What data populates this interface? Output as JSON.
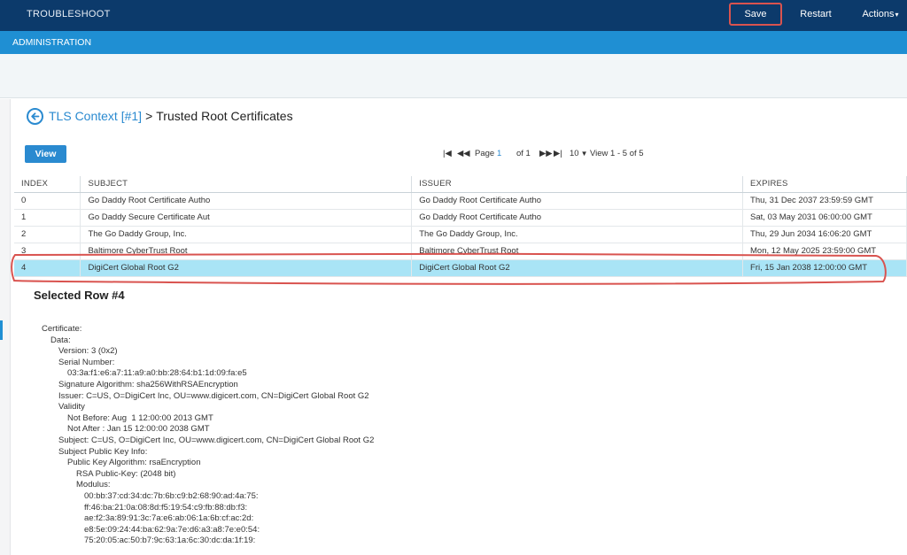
{
  "topbar": {
    "brand": "TROUBLESHOOT",
    "save_label": "Save",
    "restart_label": "Restart",
    "actions_label": "Actions",
    "highlight_color": "#d9534f"
  },
  "subbar": {
    "title": "ADMINISTRATION"
  },
  "breadcrumb": {
    "link": "TLS Context [#1]",
    "separator": ">",
    "current": "Trusted Root Certificates"
  },
  "toolbar": {
    "view_label": "View"
  },
  "pager": {
    "page_label": "Page",
    "page_number": "1",
    "of_label": "of 1",
    "page_size": "10",
    "view_text": "View 1 - 5 of 5"
  },
  "table": {
    "headers": [
      "INDEX",
      "SUBJECT",
      "ISSUER",
      "EXPIRES"
    ],
    "rows": [
      [
        "0",
        "Go Daddy Root Certificate Autho",
        "Go Daddy Root Certificate Autho",
        "Thu, 31 Dec 2037 23:59:59 GMT"
      ],
      [
        "1",
        "Go Daddy Secure Certificate Aut",
        "Go Daddy Root Certificate Autho",
        "Sat, 03 May 2031 06:00:00 GMT"
      ],
      [
        "2",
        "The Go Daddy Group, Inc.",
        "The Go Daddy Group, Inc.",
        "Thu, 29 Jun 2034 16:06:20 GMT"
      ],
      [
        "3",
        "Baltimore CyberTrust Root",
        "Baltimore CyberTrust Root",
        "Mon, 12 May 2025 23:59:00 GMT"
      ],
      [
        "4",
        "DigiCert Global Root G2",
        "DigiCert Global Root G2",
        "Fri, 15 Jan 2038 12:00:00 GMT"
      ]
    ],
    "selected_index": 4,
    "selected_color": "#a9e4f6"
  },
  "selected": {
    "title": "Selected Row #4"
  },
  "certificate": {
    "lines": [
      "Certificate:",
      "Data:",
      "Version: 3 (0x2)",
      "Serial Number:",
      "03:3a:f1:e6:a7:11:a9:a0:bb:28:64:b1:1d:09:fa:e5",
      "Signature Algorithm: sha256WithRSAEncryption",
      "Issuer: C=US, O=DigiCert Inc, OU=www.digicert.com, CN=DigiCert Global Root G2",
      "Validity",
      "Not Before: Aug  1 12:00:00 2013 GMT",
      "Not After : Jan 15 12:00:00 2038 GMT",
      "Subject: C=US, O=DigiCert Inc, OU=www.digicert.com, CN=DigiCert Global Root G2",
      "Subject Public Key Info:",
      "Public Key Algorithm: rsaEncryption",
      "RSA Public-Key: (2048 bit)",
      "Modulus:",
      "00:bb:37:cd:34:dc:7b:6b:c9:b2:68:90:ad:4a:75:",
      "ff:46:ba:21:0a:08:8d:f5:19:54:c9:fb:88:db:f3:",
      "ae:f2:3a:89:91:3c:7a:e6:ab:06:1a:6b:cf:ac:2d:",
      "e8:5e:09:24:44:ba:62:9a:7e:d6:a3:a8:7e:e0:54:",
      "75:20:05:ac:50:b7:9c:63:1a:6c:30:dc:da:1f:19:"
    ]
  }
}
